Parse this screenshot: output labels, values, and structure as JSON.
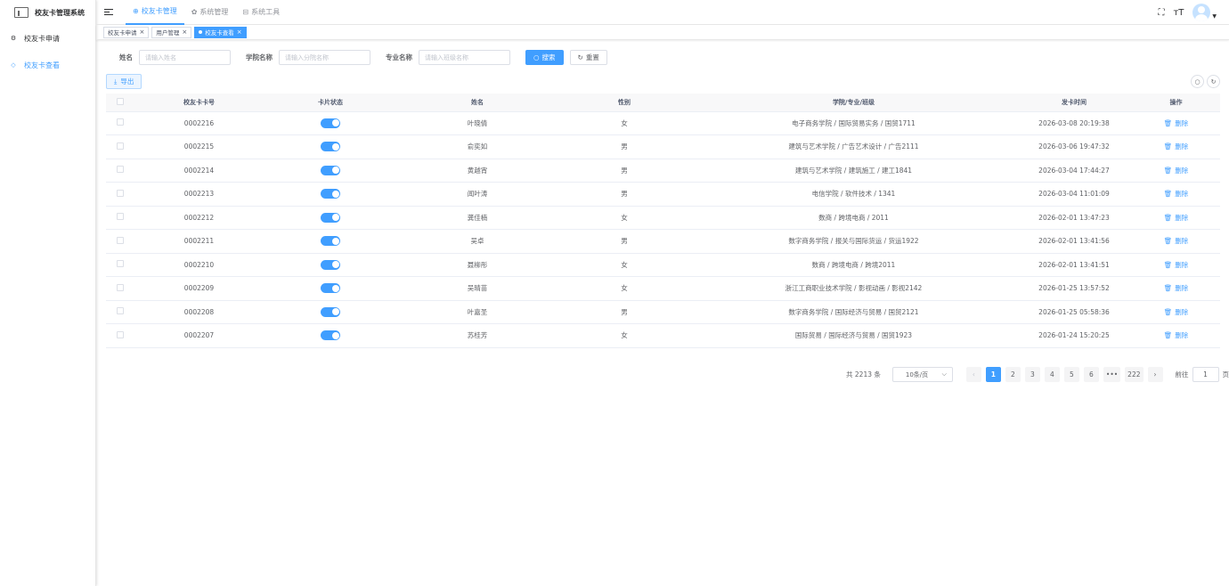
{
  "app": {
    "title": "校友卡管理系统"
  },
  "sidebar": {
    "items": [
      {
        "label": "校友卡申请",
        "icon": "settings-icon",
        "active": false
      },
      {
        "label": "校友卡查看",
        "icon": "card-icon",
        "active": true
      }
    ]
  },
  "topbar": {
    "menu": [
      {
        "label": "校友卡管理",
        "icon": "home-icon",
        "active": true
      },
      {
        "label": "系统管理",
        "icon": "gear-icon",
        "active": false
      },
      {
        "label": "系统工具",
        "icon": "toolbox-icon",
        "active": false
      }
    ],
    "icons": [
      "fullscreen-icon",
      "font-size-icon"
    ]
  },
  "tags": [
    {
      "label": "校友卡申请",
      "active": false
    },
    {
      "label": "用户管理",
      "active": false
    },
    {
      "label": "校友卡查看",
      "active": true
    }
  ],
  "search": {
    "name_label": "姓名",
    "name_placeholder": "请输入姓名",
    "college_label": "学院名称",
    "college_placeholder": "请输入分院名称",
    "major_label": "专业名称",
    "major_placeholder": "请输入班级名称",
    "search_button": "搜索",
    "reset_button": "重置"
  },
  "toolbar": {
    "export_button": "导出"
  },
  "table": {
    "columns": [
      "校友卡卡号",
      "卡片状态",
      "姓名",
      "性别",
      "学院/专业/班级",
      "发卡时间",
      "操作"
    ],
    "delete_label": "删除",
    "rows": [
      {
        "card_no": "0002216",
        "status_on": true,
        "name": "叶晓倩",
        "gender": "女",
        "dept": "电子商务学院 / 国际贸易实务 / 国贸1711",
        "issued": "2026-03-08 20:19:38"
      },
      {
        "card_no": "0002215",
        "status_on": true,
        "name": "俞奕如",
        "gender": "男",
        "dept": "建筑与艺术学院 / 广告艺术设计 / 广告2111",
        "issued": "2026-03-06 19:47:32"
      },
      {
        "card_no": "0002214",
        "status_on": true,
        "name": "黄越宵",
        "gender": "男",
        "dept": "建筑与艺术学院 / 建筑施工 / 建工1841",
        "issued": "2026-03-04 17:44:27"
      },
      {
        "card_no": "0002213",
        "status_on": true,
        "name": "闻叶涛",
        "gender": "男",
        "dept": "电信学院 / 软件技术 / 1341",
        "issued": "2026-03-04 11:01:09"
      },
      {
        "card_no": "0002212",
        "status_on": true,
        "name": "龚佳楠",
        "gender": "女",
        "dept": "数商 / 跨境电商 / 2011",
        "issued": "2026-02-01 13:47:23"
      },
      {
        "card_no": "0002211",
        "status_on": true,
        "name": "吴卓",
        "gender": "男",
        "dept": "数字商务学院 / 报关与国际货运 / 货运1922",
        "issued": "2026-02-01 13:41:56"
      },
      {
        "card_no": "0002210",
        "status_on": true,
        "name": "聂柳彤",
        "gender": "女",
        "dept": "数商 / 跨境电商 / 跨境2011",
        "issued": "2026-02-01 13:41:51"
      },
      {
        "card_no": "0002209",
        "status_on": true,
        "name": "吴晴苗",
        "gender": "女",
        "dept": "浙江工商职业技术学院 / 影视动画 / 影视2142",
        "issued": "2026-01-25 13:57:52"
      },
      {
        "card_no": "0002208",
        "status_on": true,
        "name": "叶嘉圣",
        "gender": "男",
        "dept": "数字商务学院 / 国际经济与贸易 / 国贸2121",
        "issued": "2026-01-25 05:58:36"
      },
      {
        "card_no": "0002207",
        "status_on": true,
        "name": "苏桂芳",
        "gender": "女",
        "dept": "国际贸易 / 国际经济与贸易 / 国贸1923",
        "issued": "2026-01-24 15:20:25"
      }
    ]
  },
  "pagination": {
    "total_text": "共 2213 条",
    "page_size": "10条/页",
    "pages": [
      "1",
      "2",
      "3",
      "4",
      "5",
      "6",
      "•••",
      "222"
    ],
    "current": "1",
    "goto_label": "前往",
    "goto_value": "1",
    "page_unit": "页"
  },
  "colors": {
    "primary": "#409eff"
  }
}
